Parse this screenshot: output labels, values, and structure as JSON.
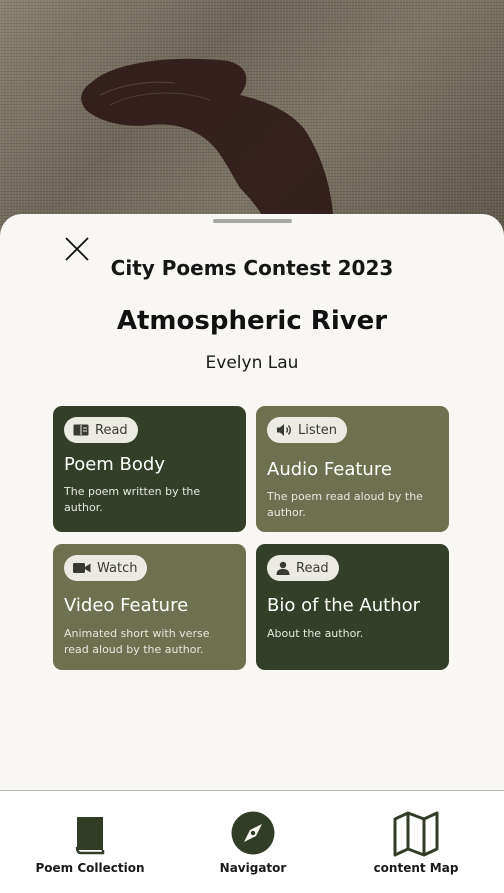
{
  "header": {
    "contest_title": "City Poems Contest 2023",
    "poem_title": "Atmospheric River",
    "author": "Evelyn Lau"
  },
  "cards": [
    {
      "badge_icon": "book-icon",
      "badge_label": "Read",
      "title": "Poem Body",
      "description": "The poem written by the author."
    },
    {
      "badge_icon": "speaker-icon",
      "badge_label": "Listen",
      "title": "Audio Feature",
      "description": "The poem read aloud by the author."
    },
    {
      "badge_icon": "video-camera-icon",
      "badge_label": "Watch",
      "title": "Video Feature",
      "description": "Animated short with verse read aloud by the author."
    },
    {
      "badge_icon": "person-icon",
      "badge_label": "Read",
      "title": "Bio of the Author",
      "description": "About the author."
    }
  ],
  "bottom_nav": {
    "items": [
      {
        "icon": "book-icon",
        "label": "Poem Collection"
      },
      {
        "icon": "compass-icon",
        "label": "Navigator"
      },
      {
        "icon": "map-icon",
        "label": "content Map"
      }
    ]
  },
  "colors": {
    "card_dark": "#333f29",
    "card_light": "#6e714f",
    "nav_icon": "#323d28",
    "sheet_background": "#f8f7f3"
  }
}
